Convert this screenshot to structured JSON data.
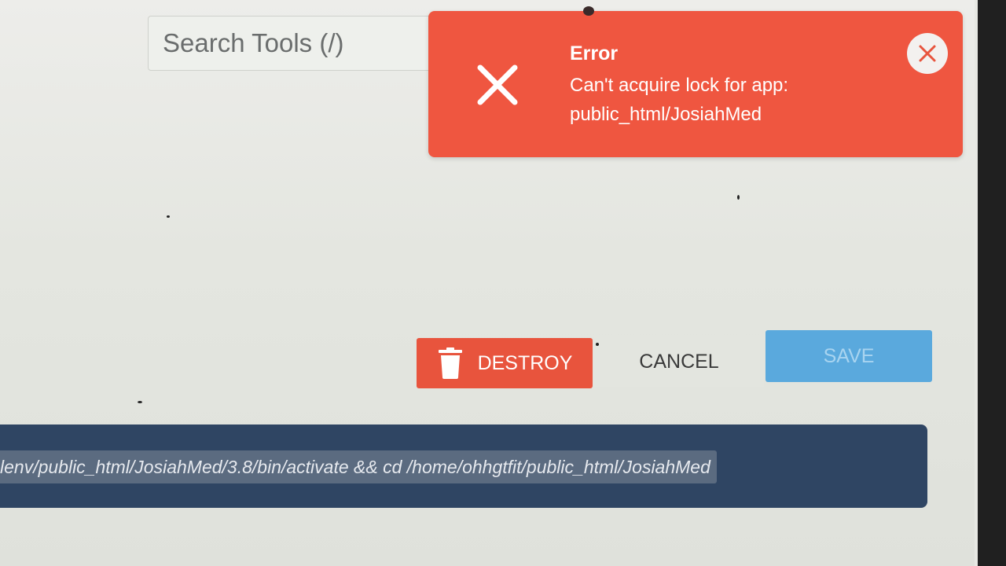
{
  "search": {
    "placeholder": "Search Tools (/)"
  },
  "toast": {
    "type": "error",
    "title": "Error",
    "message": "Can't acquire lock for app: public_html/JosiahMed",
    "icon": "x-icon",
    "close_icon": "close-icon",
    "color": "#ef5640"
  },
  "actions": {
    "destroy_label": "DESTROY",
    "destroy_icon": "trash-icon",
    "cancel_label": "CANCEL",
    "save_label": "SAVE",
    "destroy_color": "#e8543d",
    "save_color": "#5aa9dd"
  },
  "command": {
    "text": "lenv/public_html/JosiahMed/3.8/bin/activate && cd /home/ohhgtfit/public_html/JosiahMed",
    "bar_color": "#2f4563"
  }
}
